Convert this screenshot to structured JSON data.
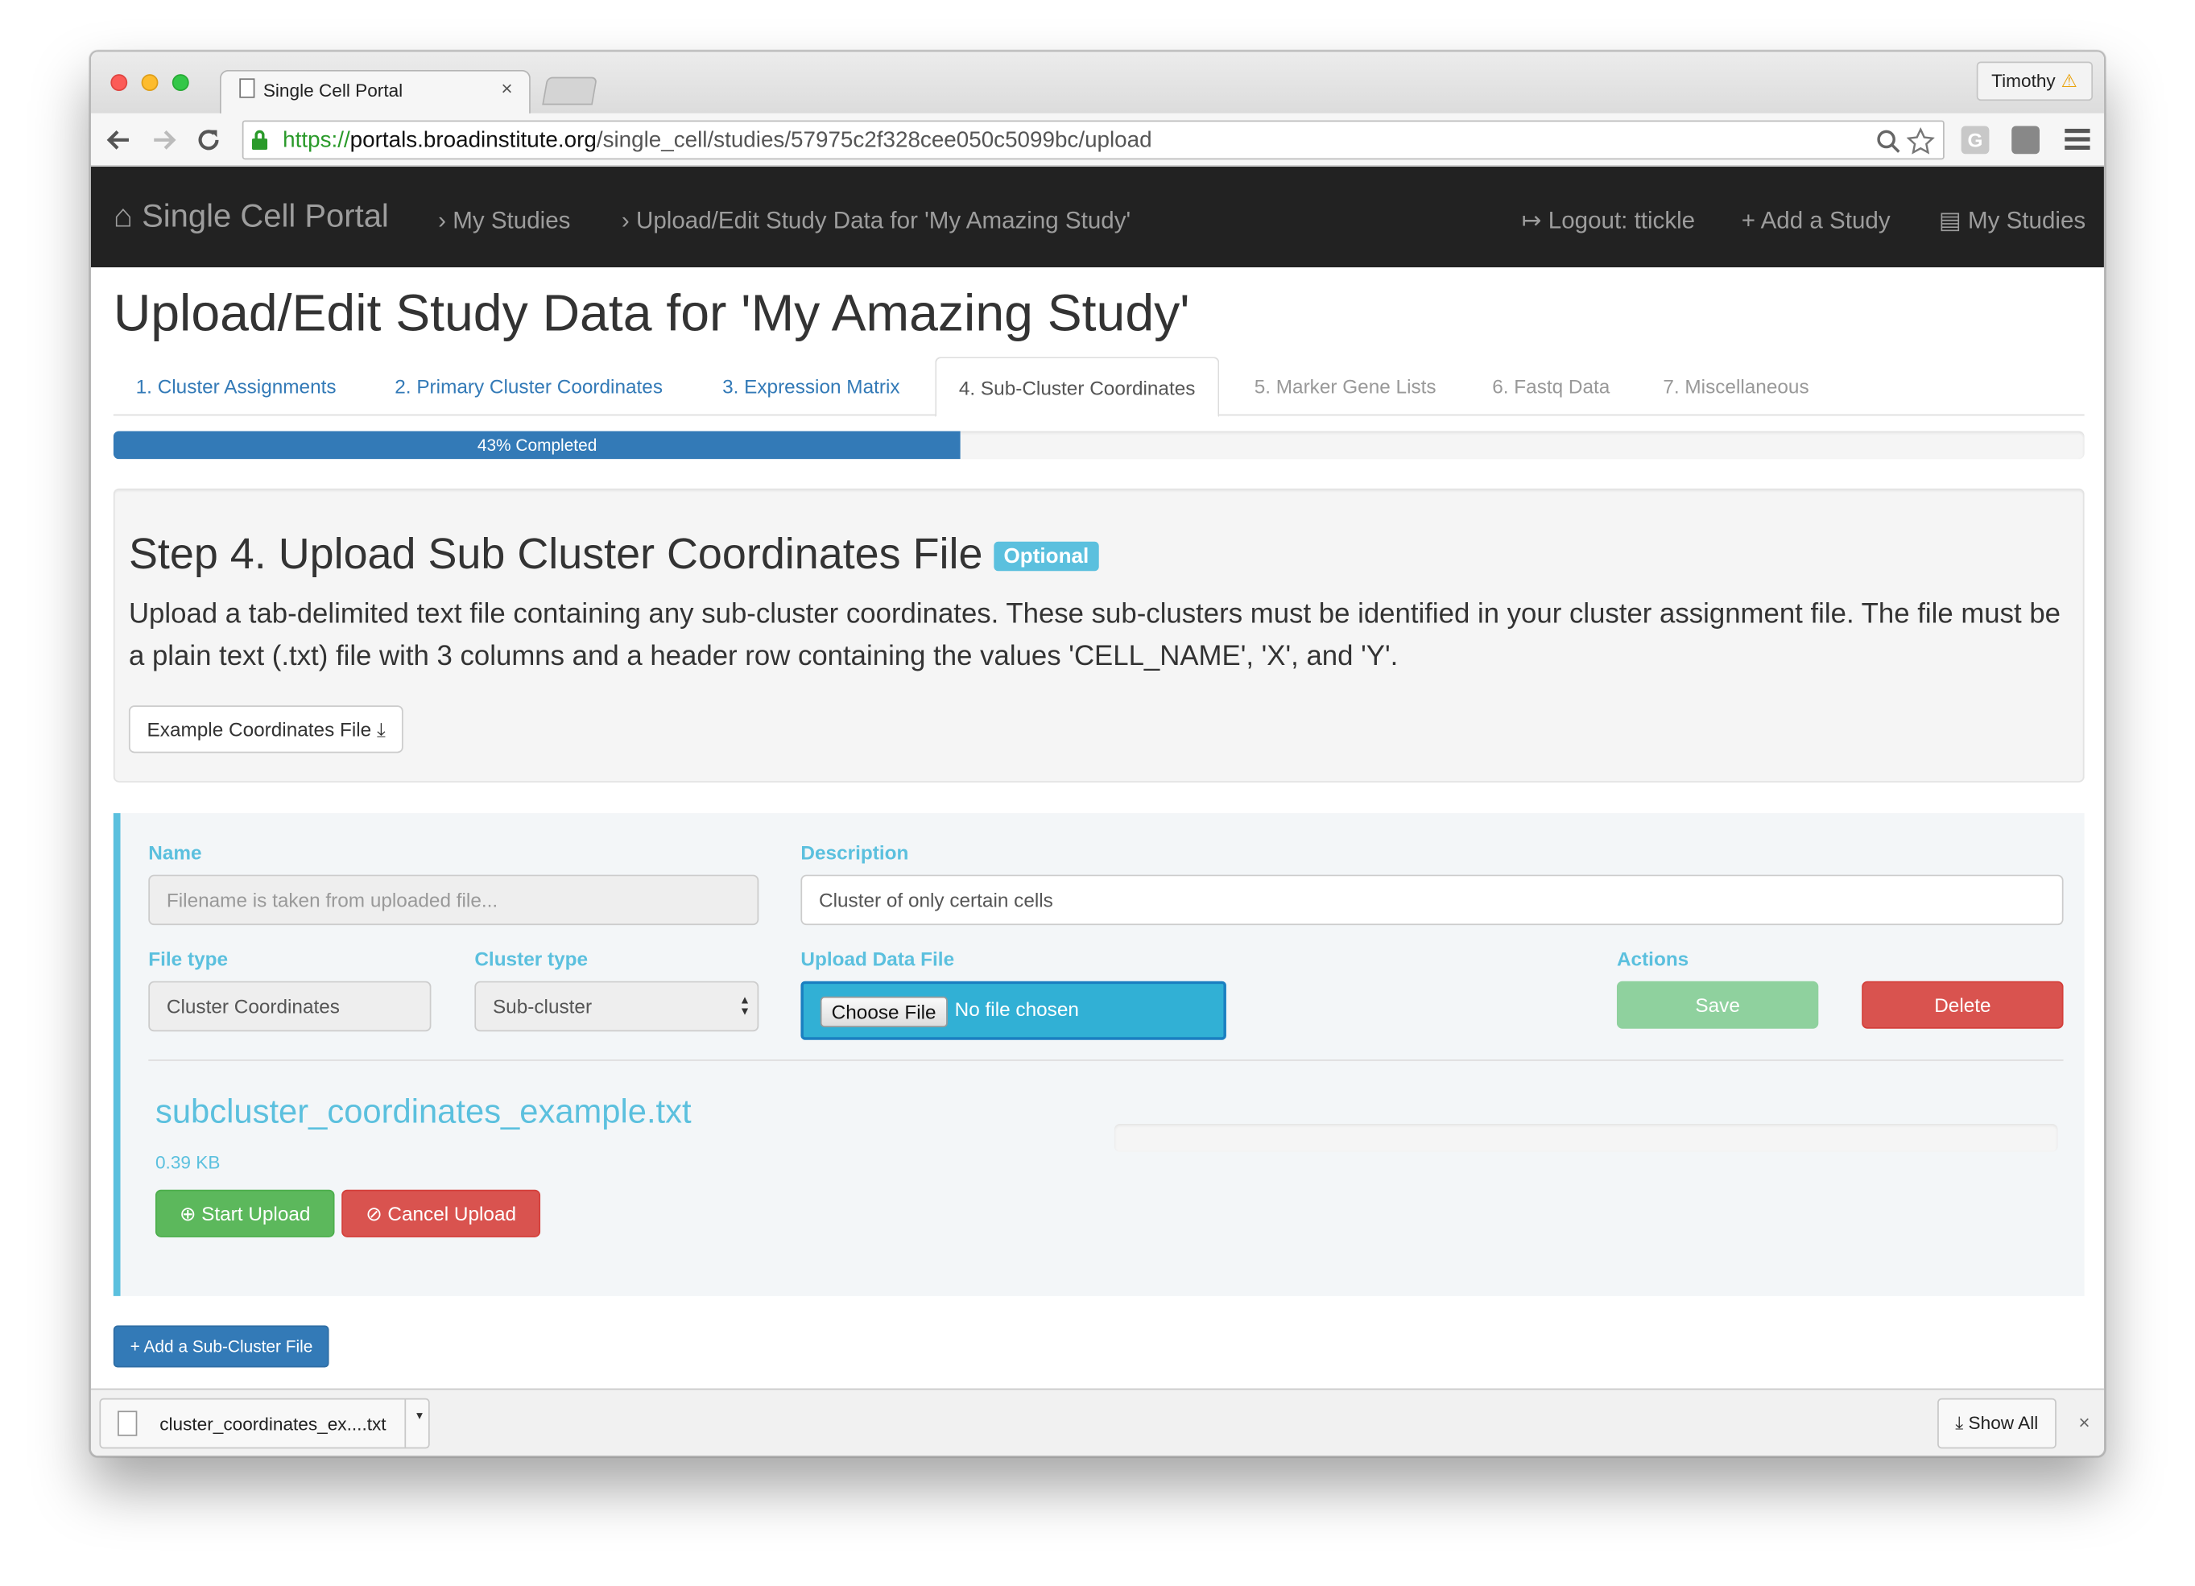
{
  "browser": {
    "tab_title": "Single Cell Portal",
    "tab_close": "×",
    "profile_name": "Timothy",
    "profile_warning": "⚠",
    "url_scheme": "https://",
    "url_host": "portals.broadinstitute.org",
    "url_path": "/single_cell/studies/57975c2f328cee050c5099bc/upload",
    "icons": [
      "back-icon",
      "forward-icon",
      "reload-icon",
      "lock-icon",
      "search-icon",
      "star-icon",
      "menu-icon"
    ]
  },
  "navbar": {
    "brand_icon": "⌂",
    "brand": "Single Cell Portal",
    "crumb_icon": "›",
    "crumbs": [
      "My Studies",
      "Upload/Edit Study Data for 'My Amazing Study'"
    ],
    "logout": "Logout: ttickle",
    "logout_icon": "↦",
    "add_study": "Add a Study",
    "add_icon": "+",
    "my_studies": "My Studies",
    "my_studies_icon": "▤",
    "bg_color": "#222222"
  },
  "page": {
    "title": "Upload/Edit Study Data for 'My Amazing Study'"
  },
  "steps": [
    {
      "label": "1. Cluster Assignments"
    },
    {
      "label": "2. Primary Cluster Coordinates"
    },
    {
      "label": "3. Expression Matrix"
    },
    {
      "label": "4. Sub-Cluster Coordinates"
    },
    {
      "label": "5. Marker Gene Lists"
    },
    {
      "label": "6. Fastq Data"
    },
    {
      "label": "7. Miscellaneous"
    }
  ],
  "progress": {
    "percent": 43,
    "label": "43% Completed"
  },
  "step_panel": {
    "title": "Step 4. Upload Sub Cluster Coordinates File",
    "badge": "Optional",
    "description": "Upload a tab-delimited text file containing any sub-cluster coordinates. These sub-clusters must be identified in your cluster assignment file. The file must be a plain text (.txt) file with 3 columns and a header row containing the values 'CELL_NAME', 'X', and 'Y'.",
    "example_button": "Example Coordinates File",
    "download_icon": "⤓"
  },
  "form": {
    "name_label": "Name",
    "name_placeholder": "Filename is taken from uploaded file...",
    "description_label": "Description",
    "description_value": "Cluster of only certain cells",
    "file_type_label": "File type",
    "file_type_value": "Cluster Coordinates",
    "cluster_type_label": "Cluster type",
    "cluster_type_value": "Sub-cluster",
    "upload_label": "Upload Data File",
    "choose_file": "Choose File",
    "no_file": "No file chosen",
    "actions_label": "Actions",
    "save": "Save",
    "delete": "Delete",
    "accent_color": "#5bc0de"
  },
  "upload_item": {
    "filename": "subcluster_coordinates_example.txt",
    "size": "0.39 KB",
    "start": "Start Upload",
    "start_icon": "⊕",
    "cancel": "Cancel Upload",
    "cancel_icon": "⊘",
    "progress": 0
  },
  "add_button": {
    "icon": "+",
    "label": "Add a Sub-Cluster File"
  },
  "downloads": {
    "item": "cluster_coordinates_ex....txt",
    "caret": "▾",
    "show_all": "Show All",
    "show_all_icon": "⤓",
    "close": "×"
  }
}
